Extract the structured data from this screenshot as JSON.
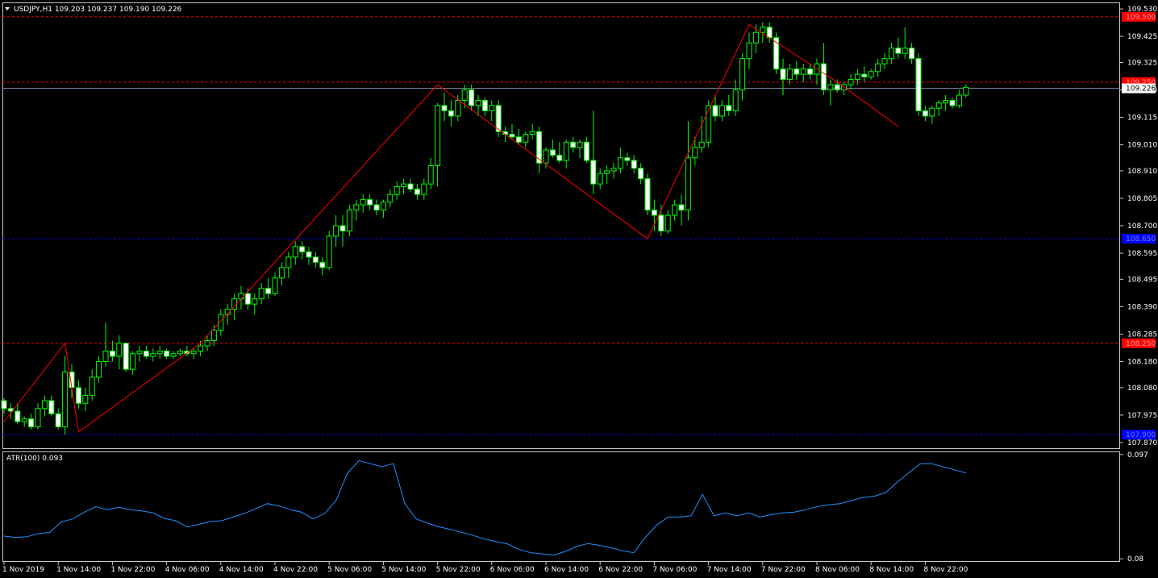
{
  "chart_data": [
    {
      "type": "candlestick",
      "symbol_header": "USDJPY,H1",
      "ohlc_header": "109.203 109.237 109.190 109.226",
      "ylim": [
        107.845,
        109.555
      ],
      "y_ticks": [
        "109.530",
        "109.425",
        "109.325",
        "109.220",
        "109.115",
        "109.010",
        "108.910",
        "108.805",
        "108.700",
        "108.595",
        "108.495",
        "108.390",
        "108.285",
        "108.180",
        "108.080",
        "107.975",
        "107.870"
      ],
      "x_ticks": [
        "1 Nov 2019",
        "1 Nov 14:00",
        "1 Nov 22:00",
        "4 Nov 06:00",
        "4 Nov 14:00",
        "4 Nov 22:00",
        "5 Nov 06:00",
        "5 Nov 14:00",
        "5 Nov 22:00",
        "6 Nov 06:00",
        "6 Nov 14:00",
        "6 Nov 22:00",
        "7 Nov 06:00",
        "7 Nov 14:00",
        "7 Nov 22:00",
        "8 Nov 06:00",
        "8 Nov 14:00",
        "8 Nov 22:00"
      ],
      "bid_price": "109.226",
      "levels": [
        {
          "price": "109.500",
          "kind": "resistance",
          "color": "#ff0000"
        },
        {
          "price": "109.250",
          "kind": "resistance",
          "color": "#ff0000"
        },
        {
          "price": "108.650",
          "kind": "support",
          "color": "#0000ff"
        },
        {
          "price": "108.250",
          "kind": "resistance",
          "color": "#ff0000"
        },
        {
          "price": "107.900",
          "kind": "support",
          "color": "#0000ff"
        }
      ],
      "zigzag": [
        [
          0,
          107.95
        ],
        [
          9,
          108.25
        ],
        [
          11,
          107.91
        ],
        [
          29,
          108.25
        ],
        [
          64,
          109.24
        ],
        [
          95,
          108.65
        ],
        [
          110,
          109.47
        ],
        [
          123,
          109.25
        ],
        [
          132,
          109.08
        ]
      ],
      "candles": [
        [
          108.03,
          108.04,
          107.98,
          108.0
        ],
        [
          108.0,
          108.02,
          107.96,
          107.99
        ],
        [
          107.99,
          108.02,
          107.94,
          107.95
        ],
        [
          107.95,
          107.97,
          107.93,
          107.96
        ],
        [
          107.96,
          107.98,
          107.92,
          107.93
        ],
        [
          107.93,
          108.02,
          107.92,
          108.0
        ],
        [
          108.0,
          108.05,
          107.97,
          108.03
        ],
        [
          108.03,
          108.05,
          107.97,
          107.98
        ],
        [
          107.98,
          108.0,
          107.92,
          107.93
        ],
        [
          107.93,
          108.2,
          107.9,
          108.14
        ],
        [
          108.14,
          108.17,
          108.04,
          108.08
        ],
        [
          108.08,
          108.11,
          108.0,
          108.02
        ],
        [
          108.02,
          108.08,
          107.99,
          108.05
        ],
        [
          108.05,
          108.15,
          108.03,
          108.12
        ],
        [
          108.12,
          108.2,
          108.1,
          108.18
        ],
        [
          108.18,
          108.33,
          108.16,
          108.22
        ],
        [
          108.22,
          108.26,
          108.18,
          108.2
        ],
        [
          108.2,
          108.28,
          108.15,
          108.25
        ],
        [
          108.25,
          108.25,
          108.14,
          108.15
        ],
        [
          108.15,
          108.22,
          108.13,
          108.21
        ],
        [
          108.21,
          108.24,
          108.18,
          108.22
        ],
        [
          108.22,
          108.24,
          108.19,
          108.2
        ],
        [
          108.2,
          108.23,
          108.18,
          108.21
        ],
        [
          108.21,
          108.24,
          108.19,
          108.22
        ],
        [
          108.22,
          108.23,
          108.19,
          108.2
        ],
        [
          108.2,
          108.22,
          108.19,
          108.21
        ],
        [
          108.21,
          108.23,
          108.2,
          108.22
        ],
        [
          108.22,
          108.24,
          108.2,
          108.21
        ],
        [
          108.21,
          108.23,
          108.19,
          108.22
        ],
        [
          108.22,
          108.26,
          108.2,
          108.24
        ],
        [
          108.24,
          108.28,
          108.22,
          108.26
        ],
        [
          108.26,
          108.32,
          108.24,
          108.3
        ],
        [
          108.3,
          108.38,
          108.28,
          108.36
        ],
        [
          108.36,
          108.4,
          108.32,
          108.38
        ],
        [
          108.38,
          108.44,
          108.34,
          108.42
        ],
        [
          108.42,
          108.47,
          108.38,
          108.44
        ],
        [
          108.44,
          108.46,
          108.38,
          108.4
        ],
        [
          108.4,
          108.44,
          108.36,
          108.42
        ],
        [
          108.42,
          108.48,
          108.4,
          108.46
        ],
        [
          108.46,
          108.5,
          108.42,
          108.44
        ],
        [
          108.44,
          108.52,
          108.43,
          108.5
        ],
        [
          108.5,
          108.56,
          108.47,
          108.54
        ],
        [
          108.54,
          108.6,
          108.5,
          108.58
        ],
        [
          108.58,
          108.64,
          108.55,
          108.62
        ],
        [
          108.62,
          108.64,
          108.57,
          108.6
        ],
        [
          108.6,
          108.62,
          108.55,
          108.58
        ],
        [
          108.58,
          108.6,
          108.54,
          108.56
        ],
        [
          108.56,
          108.58,
          108.51,
          108.54
        ],
        [
          108.54,
          108.68,
          108.53,
          108.66
        ],
        [
          108.66,
          108.74,
          108.62,
          108.7
        ],
        [
          108.7,
          108.74,
          108.62,
          108.68
        ],
        [
          108.68,
          108.78,
          108.66,
          108.76
        ],
        [
          108.76,
          108.8,
          108.72,
          108.78
        ],
        [
          108.78,
          108.82,
          108.75,
          108.8
        ],
        [
          108.8,
          108.82,
          108.76,
          108.78
        ],
        [
          108.78,
          108.8,
          108.74,
          108.76
        ],
        [
          108.76,
          108.8,
          108.73,
          108.79
        ],
        [
          108.79,
          108.84,
          108.77,
          108.82
        ],
        [
          108.82,
          108.87,
          108.8,
          108.85
        ],
        [
          108.85,
          108.88,
          108.82,
          108.86
        ],
        [
          108.86,
          108.88,
          108.83,
          108.84
        ],
        [
          108.84,
          108.86,
          108.8,
          108.82
        ],
        [
          108.82,
          108.88,
          108.8,
          108.86
        ],
        [
          108.86,
          108.96,
          108.84,
          108.93
        ],
        [
          108.93,
          109.17,
          108.85,
          109.16
        ],
        [
          109.16,
          109.21,
          109.1,
          109.14
        ],
        [
          109.14,
          109.18,
          109.08,
          109.12
        ],
        [
          109.12,
          109.2,
          109.1,
          109.18
        ],
        [
          109.18,
          109.24,
          109.15,
          109.22
        ],
        [
          109.22,
          109.24,
          109.14,
          109.16
        ],
        [
          109.16,
          109.2,
          109.12,
          109.18
        ],
        [
          109.18,
          109.19,
          109.12,
          109.14
        ],
        [
          109.14,
          109.18,
          109.1,
          109.16
        ],
        [
          109.16,
          109.18,
          109.04,
          109.06
        ],
        [
          109.06,
          109.08,
          109.02,
          109.05
        ],
        [
          109.05,
          109.09,
          109.03,
          109.04
        ],
        [
          109.04,
          109.07,
          109.01,
          109.02
        ],
        [
          109.02,
          109.06,
          109.0,
          109.05
        ],
        [
          109.05,
          109.09,
          109.03,
          109.06
        ],
        [
          109.06,
          109.08,
          108.9,
          108.94
        ],
        [
          108.94,
          109.0,
          108.92,
          108.99
        ],
        [
          108.99,
          109.03,
          108.96,
          108.97
        ],
        [
          108.97,
          109.02,
          108.94,
          108.95
        ],
        [
          108.95,
          109.03,
          108.92,
          109.02
        ],
        [
          109.02,
          109.04,
          108.98,
          109.0
        ],
        [
          109.0,
          109.03,
          108.96,
          109.02
        ],
        [
          109.02,
          109.04,
          108.94,
          108.95
        ],
        [
          108.95,
          109.14,
          108.82,
          108.86
        ],
        [
          108.86,
          108.92,
          108.84,
          108.9
        ],
        [
          108.9,
          108.93,
          108.86,
          108.91
        ],
        [
          108.91,
          108.94,
          108.88,
          108.92
        ],
        [
          108.92,
          109.0,
          108.9,
          108.96
        ],
        [
          108.96,
          108.98,
          108.93,
          108.95
        ],
        [
          108.95,
          108.97,
          108.9,
          108.92
        ],
        [
          108.92,
          108.94,
          108.86,
          108.88
        ],
        [
          108.88,
          108.9,
          108.74,
          108.76
        ],
        [
          108.76,
          108.8,
          108.68,
          108.74
        ],
        [
          108.74,
          108.78,
          108.66,
          108.68
        ],
        [
          108.68,
          108.76,
          108.67,
          108.74
        ],
        [
          108.74,
          108.8,
          108.72,
          108.78
        ],
        [
          108.78,
          108.82,
          108.7,
          108.76
        ],
        [
          108.76,
          109.1,
          108.72,
          108.96
        ],
        [
          108.96,
          109.04,
          108.93,
          109.0
        ],
        [
          109.0,
          109.12,
          108.98,
          109.02
        ],
        [
          109.02,
          109.18,
          109.0,
          109.16
        ],
        [
          109.16,
          109.2,
          109.1,
          109.12
        ],
        [
          109.12,
          109.18,
          109.1,
          109.16
        ],
        [
          109.16,
          109.2,
          109.12,
          109.14
        ],
        [
          109.14,
          109.26,
          109.12,
          109.22
        ],
        [
          109.22,
          109.36,
          109.18,
          109.34
        ],
        [
          109.34,
          109.44,
          109.3,
          109.4
        ],
        [
          109.4,
          109.47,
          109.36,
          109.44
        ],
        [
          109.44,
          109.48,
          109.4,
          109.46
        ],
        [
          109.46,
          109.48,
          109.4,
          109.42
        ],
        [
          109.42,
          109.44,
          109.28,
          109.3
        ],
        [
          109.3,
          109.34,
          109.2,
          109.26
        ],
        [
          109.26,
          109.32,
          109.24,
          109.3
        ],
        [
          109.3,
          109.33,
          109.26,
          109.28
        ],
        [
          109.28,
          109.32,
          109.25,
          109.3
        ],
        [
          109.3,
          109.32,
          109.26,
          109.28
        ],
        [
          109.28,
          109.34,
          109.24,
          109.32
        ],
        [
          109.32,
          109.4,
          109.2,
          109.22
        ],
        [
          109.22,
          109.26,
          109.16,
          109.24
        ],
        [
          109.24,
          109.26,
          109.21,
          109.22
        ],
        [
          109.22,
          109.25,
          109.2,
          109.24
        ],
        [
          109.24,
          109.28,
          109.22,
          109.26
        ],
        [
          109.26,
          109.3,
          109.24,
          109.28
        ],
        [
          109.28,
          109.31,
          109.25,
          109.27
        ],
        [
          109.27,
          109.3,
          109.26,
          109.29
        ],
        [
          109.29,
          109.34,
          109.27,
          109.32
        ],
        [
          109.32,
          109.36,
          109.3,
          109.34
        ],
        [
          109.34,
          109.4,
          109.32,
          109.38
        ],
        [
          109.38,
          109.42,
          109.34,
          109.36
        ],
        [
          109.36,
          109.46,
          109.34,
          109.38
        ],
        [
          109.38,
          109.4,
          109.32,
          109.34
        ],
        [
          109.34,
          109.36,
          109.12,
          109.14
        ],
        [
          109.14,
          109.16,
          109.1,
          109.12
        ],
        [
          109.12,
          109.16,
          109.09,
          109.15
        ],
        [
          109.15,
          109.18,
          109.12,
          109.17
        ],
        [
          109.17,
          109.2,
          109.14,
          109.18
        ],
        [
          109.18,
          109.19,
          109.15,
          109.16
        ],
        [
          109.16,
          109.22,
          109.15,
          109.2
        ],
        [
          109.2,
          109.24,
          109.19,
          109.23
        ]
      ]
    },
    {
      "type": "line",
      "header": "ATR(100) 0.093",
      "ylim": [
        0.0795,
        0.0975
      ],
      "y_ticks": [
        "0.097",
        "0.08"
      ],
      "color": "#1e90ff",
      "values": [
        0.0837,
        0.0835,
        0.0836,
        0.0841,
        0.0843,
        0.086,
        0.0865,
        0.0876,
        0.0885,
        0.088,
        0.0884,
        0.088,
        0.0878,
        0.0875,
        0.0866,
        0.0862,
        0.0852,
        0.0856,
        0.0861,
        0.0862,
        0.0868,
        0.0874,
        0.0882,
        0.089,
        0.0886,
        0.088,
        0.0876,
        0.0865,
        0.0874,
        0.0895,
        0.094,
        0.096,
        0.0955,
        0.095,
        0.0955,
        0.089,
        0.0865,
        0.0858,
        0.0852,
        0.0848,
        0.0843,
        0.0838,
        0.0832,
        0.0828,
        0.0824,
        0.0815,
        0.081,
        0.0808,
        0.0806,
        0.0812,
        0.082,
        0.0825,
        0.0822,
        0.0818,
        0.0813,
        0.081,
        0.0835,
        0.0855,
        0.0868,
        0.0868,
        0.087,
        0.0905,
        0.087,
        0.0875,
        0.087,
        0.0875,
        0.0868,
        0.0872,
        0.0875,
        0.0876,
        0.088,
        0.0885,
        0.0888,
        0.089,
        0.0895,
        0.09,
        0.0902,
        0.0908,
        0.0925,
        0.094,
        0.0955,
        0.0955,
        0.095,
        0.0945,
        0.094
      ]
    }
  ]
}
